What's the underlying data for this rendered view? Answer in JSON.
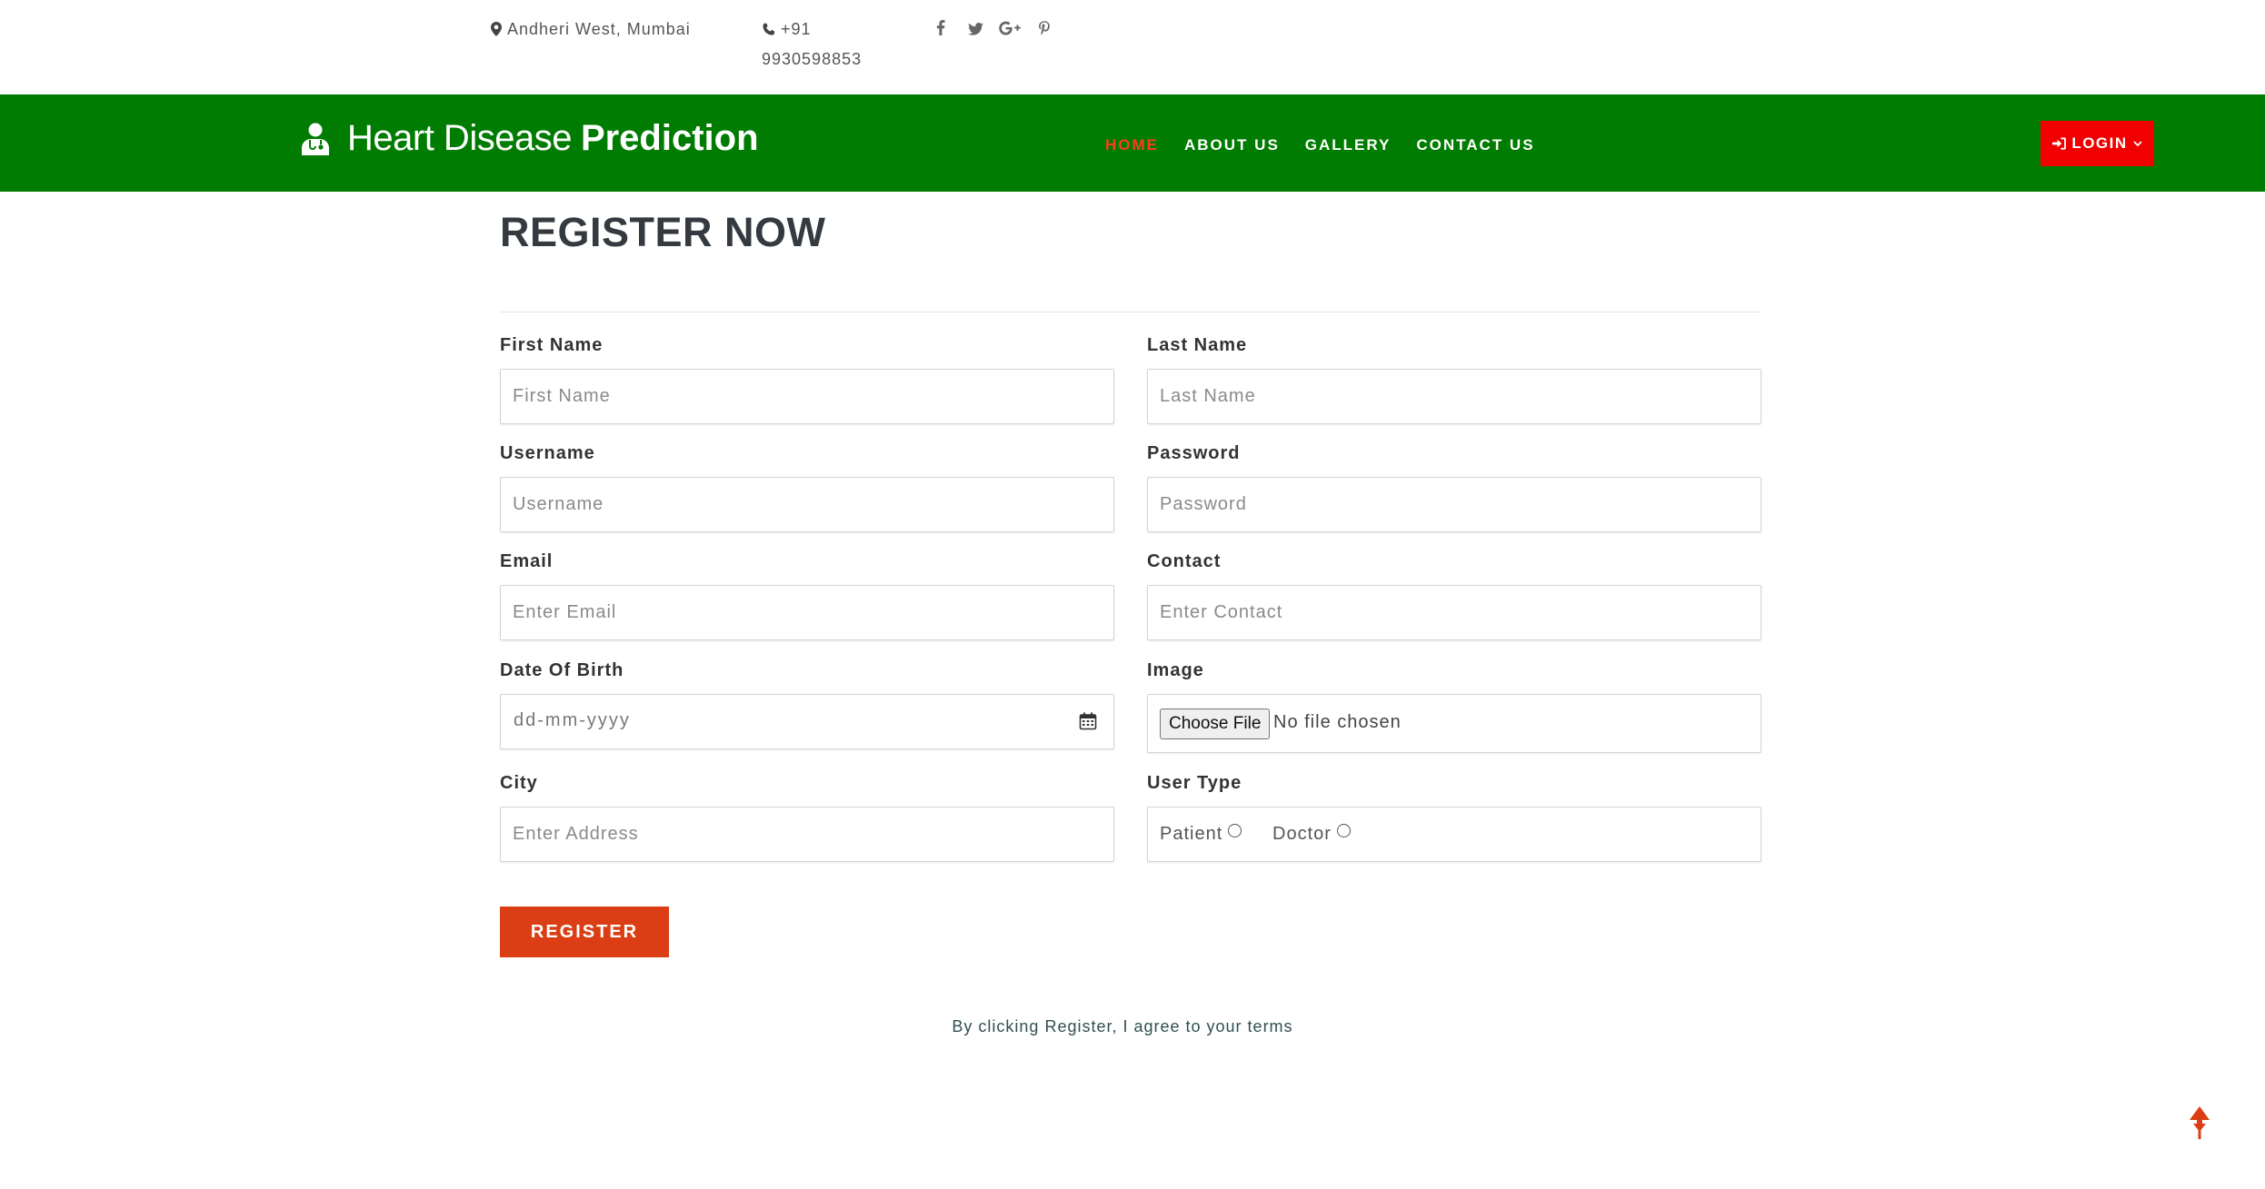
{
  "topbar": {
    "location": "Andheri West, Mumbai",
    "phone_line1": "+91",
    "phone_line2": "9930598853",
    "social_icons": [
      "facebook-icon",
      "twitter-icon",
      "google-plus-icon",
      "pinterest-icon"
    ]
  },
  "navbar": {
    "brand_light": "Heart Disease",
    "brand_bold": "Prediction",
    "items": [
      {
        "label": "HOME",
        "active": true
      },
      {
        "label": "ABOUT US",
        "active": false
      },
      {
        "label": "GALLERY",
        "active": false
      },
      {
        "label": "CONTACT US",
        "active": false
      }
    ],
    "login_label": "LOGIN"
  },
  "form": {
    "title": "REGISTER NOW",
    "first_name": {
      "label": "First Name",
      "placeholder": "First Name"
    },
    "last_name": {
      "label": "Last Name",
      "placeholder": "Last Name"
    },
    "username": {
      "label": "Username",
      "placeholder": "Username"
    },
    "password": {
      "label": "Password",
      "placeholder": "Password"
    },
    "email": {
      "label": "Email",
      "placeholder": "Enter Email"
    },
    "contact": {
      "label": "Contact",
      "placeholder": "Enter Contact"
    },
    "dob": {
      "label": "Date Of Birth",
      "placeholder": "dd-mm-yyyy"
    },
    "image": {
      "label": "Image",
      "button": "Choose File",
      "status": "No file chosen"
    },
    "city": {
      "label": "City",
      "placeholder": "Enter Address"
    },
    "user_type": {
      "label": "User Type",
      "options": [
        "Patient",
        "Doctor"
      ]
    },
    "submit_label": "REGISTER",
    "terms": "By clicking Register, I agree to your terms"
  },
  "colors": {
    "navbar": "#017c02",
    "active_nav": "#ff3b1f",
    "login": "#f00000",
    "register": "#db3e14"
  }
}
